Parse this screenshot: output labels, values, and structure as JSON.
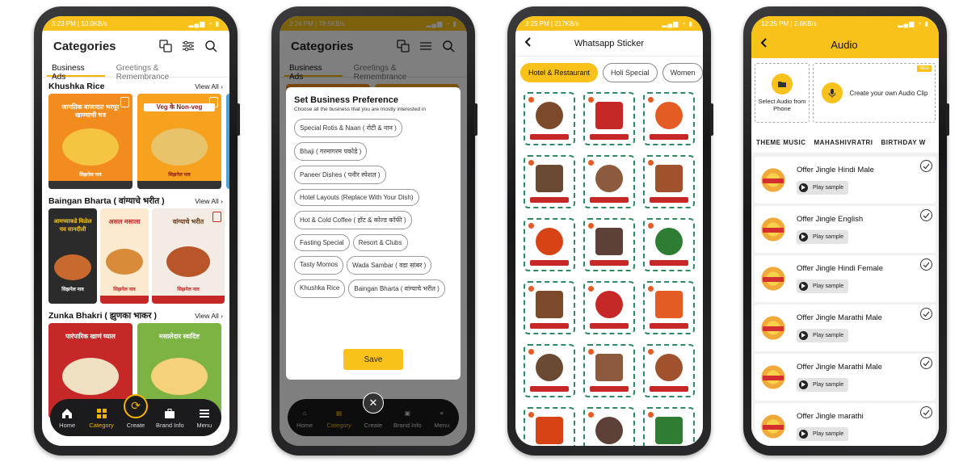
{
  "screen1": {
    "status": "3:23 PM | 10.0KB/s",
    "title": "Categories",
    "tabs": [
      "Business Ads",
      "Greetings & Remembrance"
    ],
    "view_all": "View All",
    "sections": [
      {
        "title": "Khushka Rice",
        "cards": [
          {
            "text": "जागतिक बाजारात भरपूर खाण्याची चव",
            "foot": "सिझनेल नाव",
            "bg": "#f28c1e",
            "plate": "#f5c542"
          },
          {
            "text": "Veg के Non-veg",
            "foot": "सिझनेल नाव",
            "bg": "#f6a21e",
            "plate": "#e8c36a"
          }
        ]
      },
      {
        "title": "Baingan Bharta ( वांग्याचे भरीत )",
        "cards": [
          {
            "text": "आमच्याकडे मिळेल चव सानदीली",
            "foot": "सिझनेल नाव",
            "bg": "#2b2b2b",
            "plate": "#c86a2e"
          },
          {
            "text": "असल मसाला",
            "foot": "सिझनेल नाव",
            "bg": "#fbe9d0",
            "plate": "#d98b3a"
          },
          {
            "text": "वांग्याचे भरीत",
            "foot": "सिझनेल नाव",
            "bg": "#f3ece4",
            "plate": "#b8562a"
          }
        ]
      },
      {
        "title": "Zunka Bhakri ( झुणका भाकर )",
        "cards": [
          {
            "text": "पारंपारिक खाणं घ्याल",
            "foot": "",
            "bg": "#c62828",
            "plate": "#efe0c2"
          },
          {
            "text": "मसालेदार स्वादिष्ट",
            "foot": "",
            "bg": "#7cb342",
            "plate": "#f5d27a"
          }
        ]
      }
    ],
    "nav": [
      {
        "label": "Home",
        "icon": "home-icon"
      },
      {
        "label": "Category",
        "icon": "category-icon"
      },
      {
        "label": "Create",
        "icon": "create-icon"
      },
      {
        "label": "Brand Info",
        "icon": "briefcase-icon"
      },
      {
        "label": "Menu",
        "icon": "menu-icon"
      }
    ]
  },
  "screen2": {
    "status": "3:24 PM | 78.5KB/s",
    "title": "Categories",
    "tabs": [
      "Business Ads",
      "Greetings & Remembrance"
    ],
    "modal_title": "Set Business Preference",
    "modal_sub": "Choose all the business that you are mostly interested in",
    "chips": [
      "Special Rotis & Naan ( रोटी & नान )",
      "Bhaji ( गरमागरम पकोडे )",
      "Paneer Dishes ( पनीर स्पेशल )",
      "Hotel Layouts (Replace With Your Dish)",
      "Hot & Cold Coffee ( हॉट & कोल्ड कॉफी )",
      "Fasting Special",
      "Resort & Clubs",
      "Tasty Momos",
      "Wada Sambar ( वडा सांबर )",
      "Khushka Rice",
      "Baingan Bharta ( वांग्याचे भरीत )"
    ],
    "save": "Save",
    "nav": [
      "Home",
      "Category",
      "Create",
      "Brand Info",
      "Menu"
    ]
  },
  "screen3": {
    "status": "3:25 PM | 217KB/s",
    "title": "Whatsapp Sticker",
    "tabs": [
      "Hotel & Restaurant",
      "Holi Special",
      "Women"
    ],
    "sticker_count": 18
  },
  "screen4": {
    "status": "12:25 PM | 2.6KB/s",
    "title": "Audio",
    "select_audio": "Select Audio from Phone",
    "create_clip": "Create your own Audio Clip",
    "new_badge": "NEW",
    "categories": [
      "THEME MUSIC",
      "MAHASHIVRATRI",
      "BIRTHDAY W"
    ],
    "play_label": "Play sample",
    "tracks": [
      "Offer Jingle Hindi Male",
      "Offer Jingle English",
      "Offer Jingle Hindi Female",
      "Offer Jingle Marathi Male",
      "Offer Jingle Marathi Male",
      "Offer Jingle marathi"
    ]
  },
  "colors": {
    "accent": "#f9c21a",
    "navbar": "#1b1b1d",
    "sticker_border": "#2f8a64"
  }
}
